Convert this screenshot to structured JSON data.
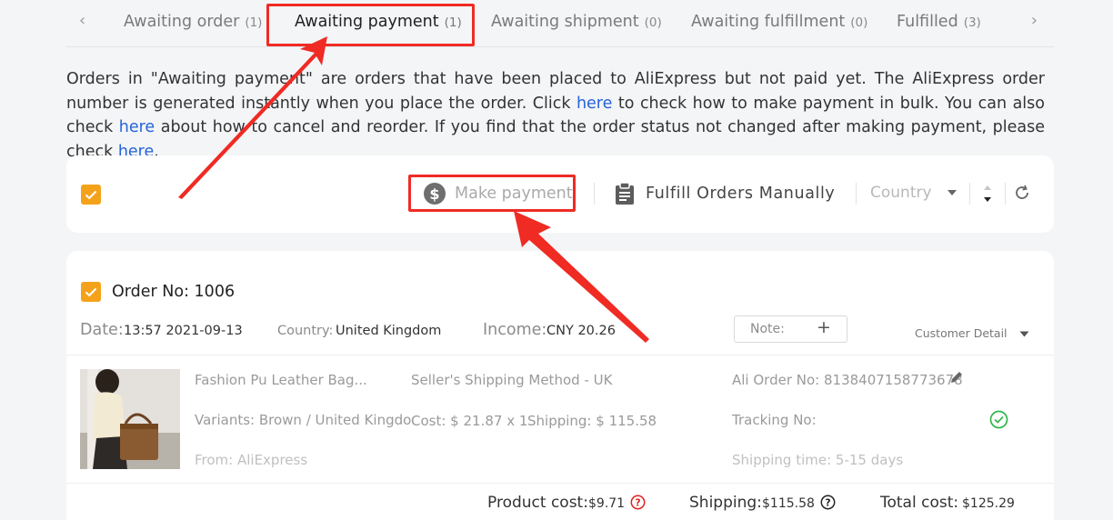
{
  "tabs": {
    "prev_icon": "chevron-left-icon",
    "next_icon": "chevron-right-icon",
    "items": [
      {
        "label": "Awaiting order",
        "count": "(1)"
      },
      {
        "label": "Awaiting payment",
        "count": "(1)",
        "active": true
      },
      {
        "label": "Awaiting shipment",
        "count": "(0)"
      },
      {
        "label": "Awaiting fulfillment",
        "count": "(0)"
      },
      {
        "label": "Fulfilled",
        "count": "(3)"
      }
    ]
  },
  "info": {
    "part1": "Orders in \"Awaiting payment\" are orders that have been placed to AliExpress but not paid yet. The AliExpress order number is generated instantly when you place the order. Click ",
    "link1": "here",
    "part2": " to check how to make payment in bulk. You can also check ",
    "link2": "here",
    "part3": " about how to cancel and reorder. If you find that the order status not changed after making payment, please check ",
    "link3": "here",
    "part4": "."
  },
  "toolbar": {
    "make_payment_label": "Make payment",
    "fulfill_label": "Fulfill Orders Manually",
    "country_label": "Country",
    "icons": [
      "dollar-icon",
      "clipboard-icon",
      "caret-down-icon",
      "sort-icon",
      "refresh-icon"
    ]
  },
  "order": {
    "order_no_label": "Order No: 1006",
    "date_label": "Date:",
    "date_value": "13:57 2021-09-13",
    "country_label": "Country:",
    "country_value": "United Kingdom",
    "income_label": "Income:",
    "income_value": "CNY 20.26",
    "note_label": "Note:",
    "note_plus": "+",
    "customer_detail": "Customer Detail",
    "product": {
      "title": "Fashion Pu Leather Bag...",
      "variants": "Variants: Brown / United Kingdo",
      "from": "From: AliExpress",
      "shipping_method": "Seller's Shipping Method - UK",
      "cost": "Cost: $ 21.87 x 1",
      "shipping": "Shipping: $ 115.58",
      "ali_order_no": "Ali Order No: 8138407158773678",
      "tracking_no": "Tracking No:",
      "shipping_time": "Shipping time: 5-15 days"
    },
    "totals": {
      "product_cost_label": "Product cost:",
      "product_cost_value": "$9.71",
      "shipping_label": "Shipping:",
      "shipping_value": "$115.58",
      "total_label": "Total cost:",
      "total_value": "$125.29"
    }
  },
  "colors": {
    "accent": "#f5a21b",
    "highlight_red": "#ef2b24",
    "link_blue": "#2563d8",
    "success_green": "#2fb64a"
  }
}
